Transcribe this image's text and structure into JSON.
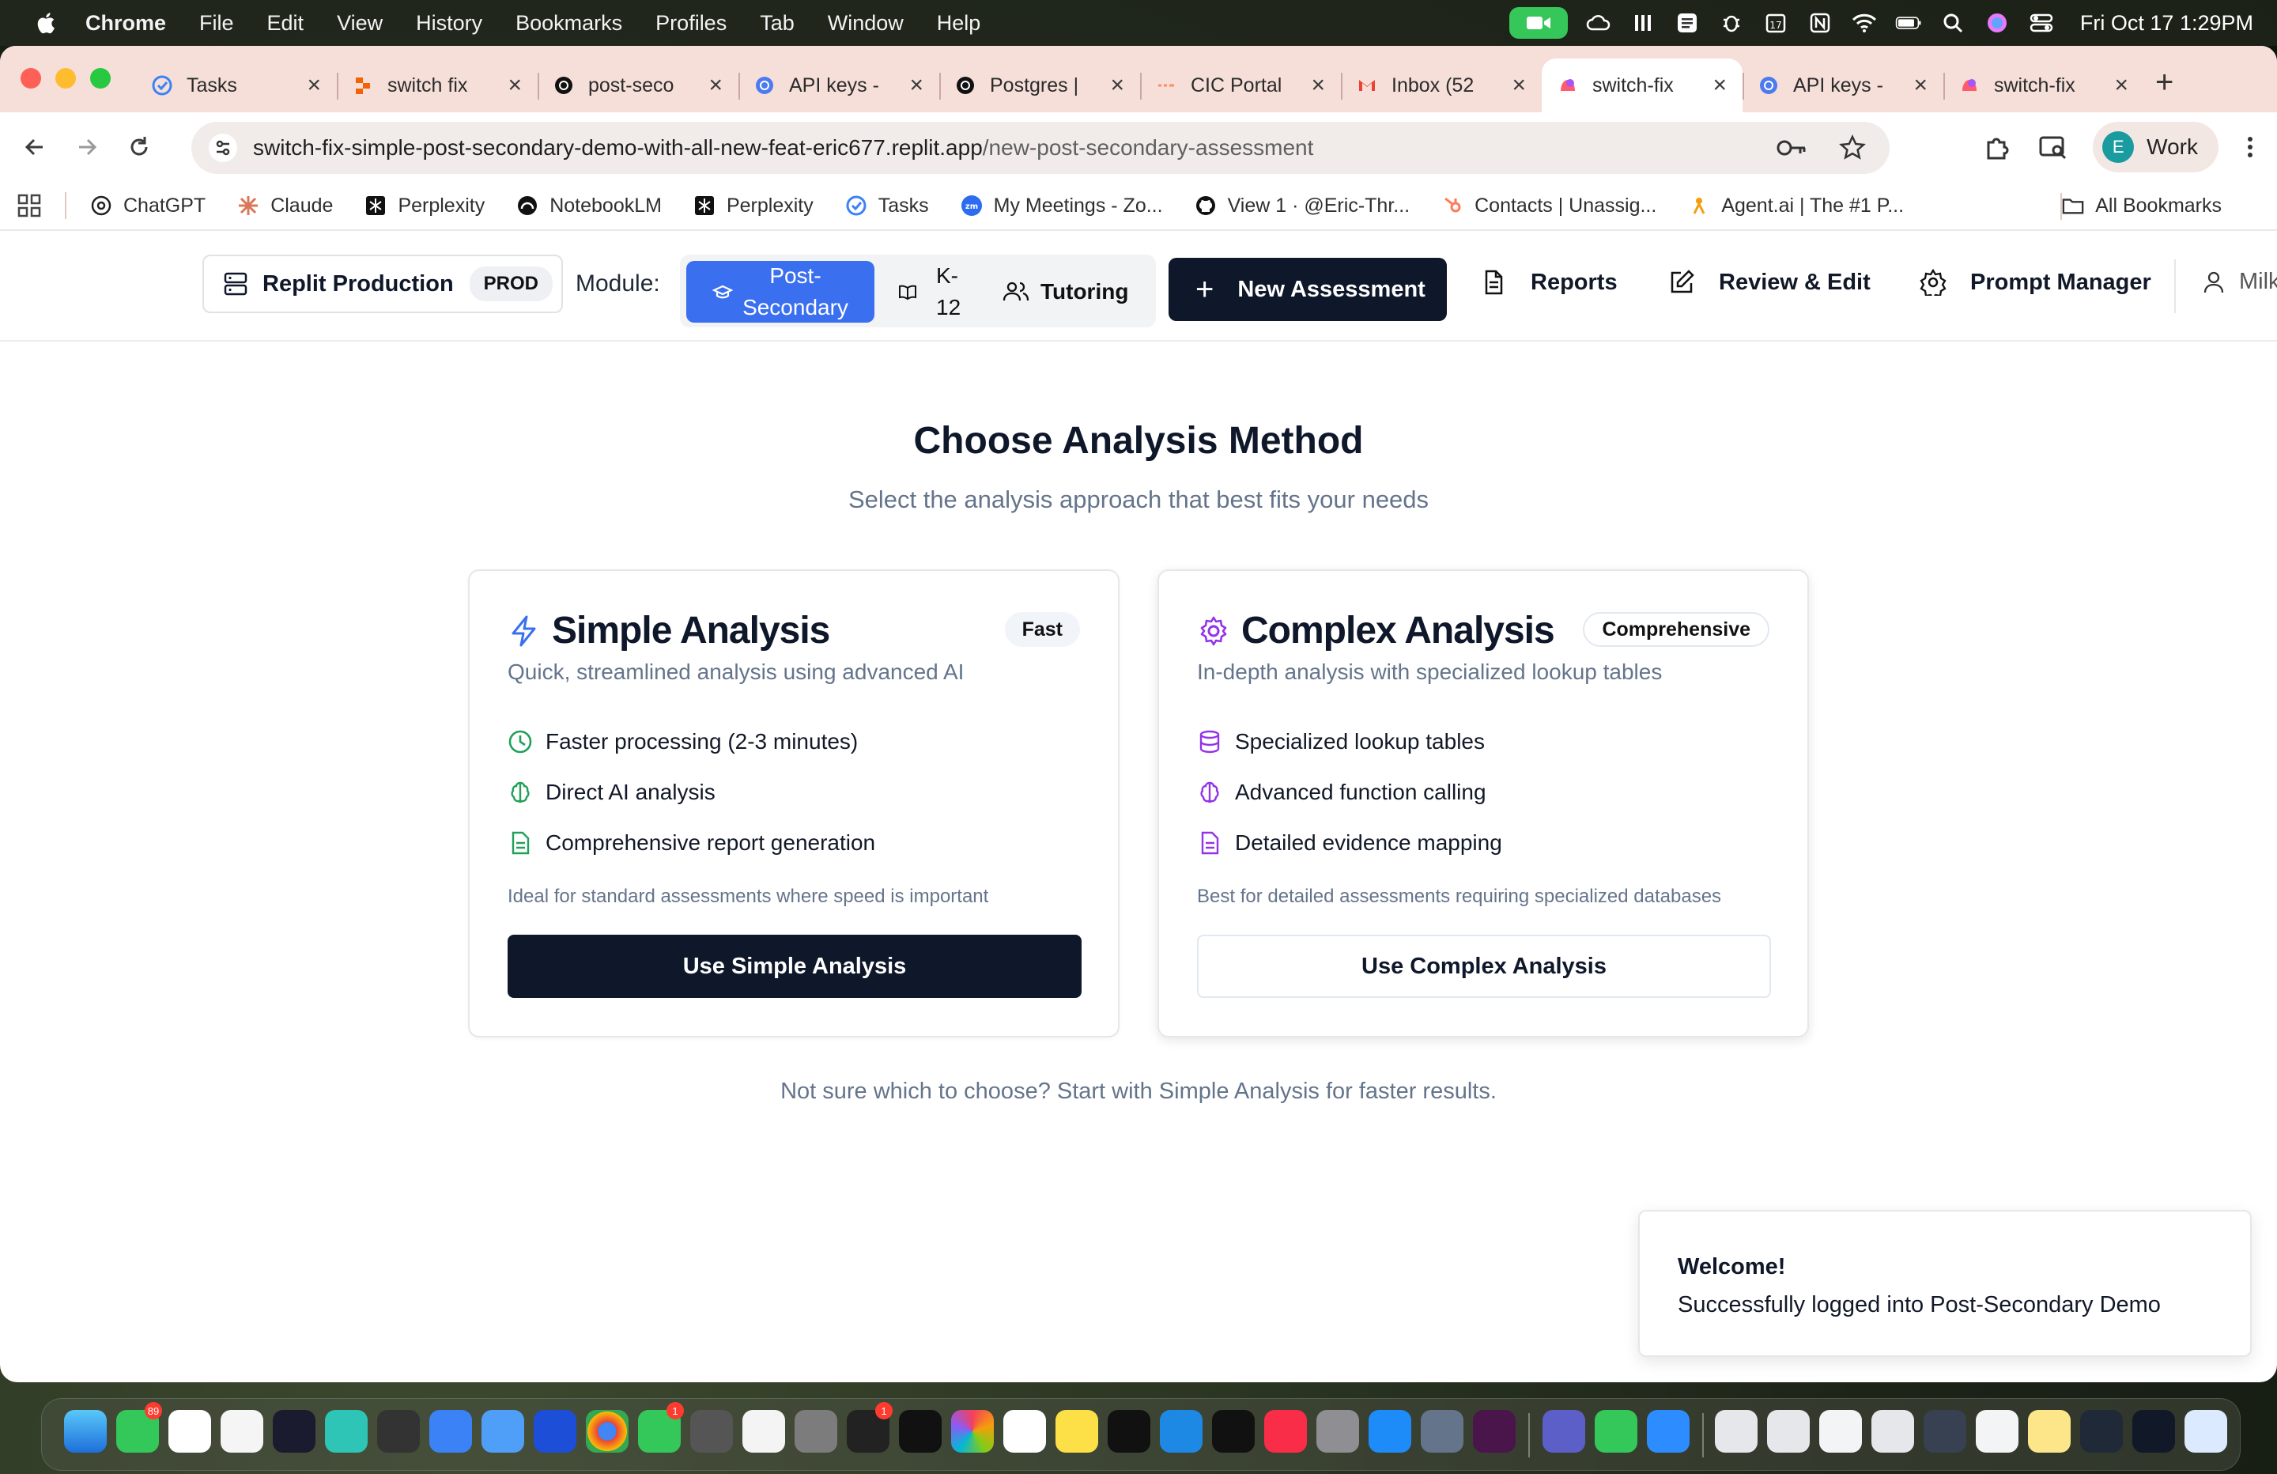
{
  "menubar": {
    "app": "Chrome",
    "items": [
      "File",
      "Edit",
      "View",
      "History",
      "Bookmarks",
      "Profiles",
      "Tab",
      "Window",
      "Help"
    ],
    "clock": "Fri Oct 17  1:29PM"
  },
  "tabs": [
    {
      "title": "Tasks",
      "icon": "tasks-check-icon",
      "color": "#3b82f6"
    },
    {
      "title": "switch fix",
      "icon": "replit-icon",
      "color": "#f26207"
    },
    {
      "title": "post-seco",
      "icon": "openai-icon",
      "color": "#111111"
    },
    {
      "title": "API keys -",
      "icon": "openai-blue-icon",
      "color": "#4c7bf0"
    },
    {
      "title": "Postgres |",
      "icon": "openai-icon",
      "color": "#111111"
    },
    {
      "title": "CIC Portal",
      "icon": "dash-arrow-icon",
      "color": "#ff8a65"
    },
    {
      "title": "Inbox (52",
      "icon": "gmail-icon",
      "color": "#ea4335"
    },
    {
      "title": "switch-fix",
      "icon": "app-favicon-icon",
      "color": "#ff5a6e",
      "active": true
    },
    {
      "title": "API keys -",
      "icon": "openai-blue-icon",
      "color": "#4c7bf0"
    },
    {
      "title": "switch-fix",
      "icon": "app-favicon-icon",
      "color": "#ff5a6e"
    }
  ],
  "omnibox": {
    "host": "switch-fix-simple-post-secondary-demo-with-all-new-feat-eric677.replit.app",
    "path": "/new-post-secondary-assessment"
  },
  "profile": {
    "initial": "E",
    "label": "Work"
  },
  "bookmarks": [
    {
      "label": "ChatGPT",
      "icon": "chatgpt-icon"
    },
    {
      "label": "Claude",
      "icon": "claude-icon"
    },
    {
      "label": "Perplexity",
      "icon": "perplexity-icon"
    },
    {
      "label": "NotebookLM",
      "icon": "notebooklm-icon"
    },
    {
      "label": "Perplexity",
      "icon": "perplexity-icon"
    },
    {
      "label": "Tasks",
      "icon": "tasks-check-icon"
    },
    {
      "label": "My Meetings - Zo...",
      "icon": "zoom-icon"
    },
    {
      "label": "View 1 · @Eric-Thr...",
      "icon": "github-icon"
    },
    {
      "label": "Contacts | Unassig...",
      "icon": "hubspot-icon"
    },
    {
      "label": "Agent.ai | The #1 P...",
      "icon": "agentai-icon"
    }
  ],
  "all_bookmarks": "All Bookmarks",
  "header": {
    "env_name": "Replit Production",
    "env_badge": "PROD",
    "module_label": "Module:",
    "modules": {
      "post_secondary": "Post-\nSecondary",
      "k12": "K-\n12",
      "tutoring": "Tutoring"
    },
    "new_assessment": "New Assessment",
    "reports": "Reports",
    "review_edit": "Review & Edit",
    "prompt_manager": "Prompt Manager",
    "user": "Milk"
  },
  "main": {
    "title": "Choose Analysis Method",
    "subtitle": "Select the analysis approach that best fits your needs",
    "hint": "Not sure which to choose? Start with Simple Analysis for faster results."
  },
  "cards": {
    "simple": {
      "title": "Simple Analysis",
      "badge": "Fast",
      "description": "Quick, streamlined analysis using advanced AI",
      "features": [
        "Faster processing (2-3 minutes)",
        "Direct AI analysis",
        "Comprehensive report generation"
      ],
      "note": "Ideal for standard assessments where speed is important",
      "button": "Use Simple Analysis",
      "accent": "#3a6ff0",
      "feature_color": "#22a05a"
    },
    "complex": {
      "title": "Complex Analysis",
      "badge": "Comprehensive",
      "description": "In-depth analysis with specialized lookup tables",
      "features": [
        "Specialized lookup tables",
        "Advanced function calling",
        "Detailed evidence mapping"
      ],
      "note": "Best for detailed assessments requiring specialized databases",
      "button": "Use Complex Analysis",
      "accent": "#9333ea"
    }
  },
  "toast": {
    "title": "Welcome!",
    "message": "Successfully logged into Post-Secondary Demo"
  },
  "dock_badges": [
    "89",
    "1",
    "1"
  ]
}
